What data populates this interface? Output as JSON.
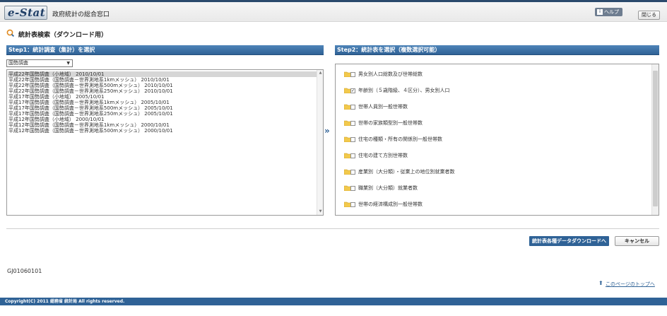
{
  "header": {
    "logo": "e-Stat",
    "site_name": "政府統計の総合窓口",
    "help_label": "ヘルプ",
    "help_icon": "i",
    "close_label": "閉じる"
  },
  "page_title": "統計表検索（ダウンロード用）",
  "step1": {
    "title": "Step1：統計調査（集計）を選択",
    "survey_select": "国勢調査",
    "items": [
      "平成22年国勢調査（小地域） 2010/10/01",
      "平成22年国勢調査（国勢調査－世界測地系1kmメッシュ） 2010/10/01",
      "平成22年国勢調査（国勢調査－世界測地系500mメッシュ） 2010/10/01",
      "平成22年国勢調査（国勢調査－世界測地系250mメッシュ） 2010/10/01",
      "平成17年国勢調査（小地域） 2005/10/01",
      "平成17年国勢調査（国勢調査－世界測地系1kmメッシュ） 2005/10/01",
      "平成17年国勢調査（国勢調査－世界測地系500mメッシュ） 2005/10/01",
      "平成17年国勢調査（国勢調査－世界測地系250mメッシュ） 2005/10/01",
      "平成12年国勢調査（小地域） 2000/10/01",
      "平成12年国勢調査（国勢調査－世界測地系1kmメッシュ） 2000/10/01",
      "平成12年国勢調査（国勢調査－世界測地系500mメッシュ） 2000/10/01"
    ]
  },
  "arrow": "»",
  "step2": {
    "title": "Step2：統計表を選択（複数選択可能）",
    "items": [
      {
        "label": "男女別人口総数及び世帯総数",
        "checked": false
      },
      {
        "label": "年齢別（５歳階級、４区分）、男女別人口",
        "checked": true
      },
      {
        "label": "世帯人員別一般世帯数",
        "checked": false
      },
      {
        "label": "世帯の家族類型別一般世帯数",
        "checked": false
      },
      {
        "label": "住宅の種類・所有の関係別一般世帯数",
        "checked": false
      },
      {
        "label": "住宅の建て方別世帯数",
        "checked": false
      },
      {
        "label": "産業別（大分類）・従業上の地位別就業者数",
        "checked": false
      },
      {
        "label": "職業別（大分類）就業者数",
        "checked": false
      },
      {
        "label": "世帯の経済構成別一般世帯数",
        "checked": false
      }
    ]
  },
  "buttons": {
    "download": "統計表各種データダウンロードへ",
    "cancel": "キャンセル"
  },
  "screen_id": "GJ01060101",
  "top_link": "このページのトップへ",
  "footer": "Copyright(C) 2011 総務省 統計局 All rights reserved.",
  "colors": {
    "accent": "#2f6296",
    "header_bar": "#2b4a6d"
  }
}
